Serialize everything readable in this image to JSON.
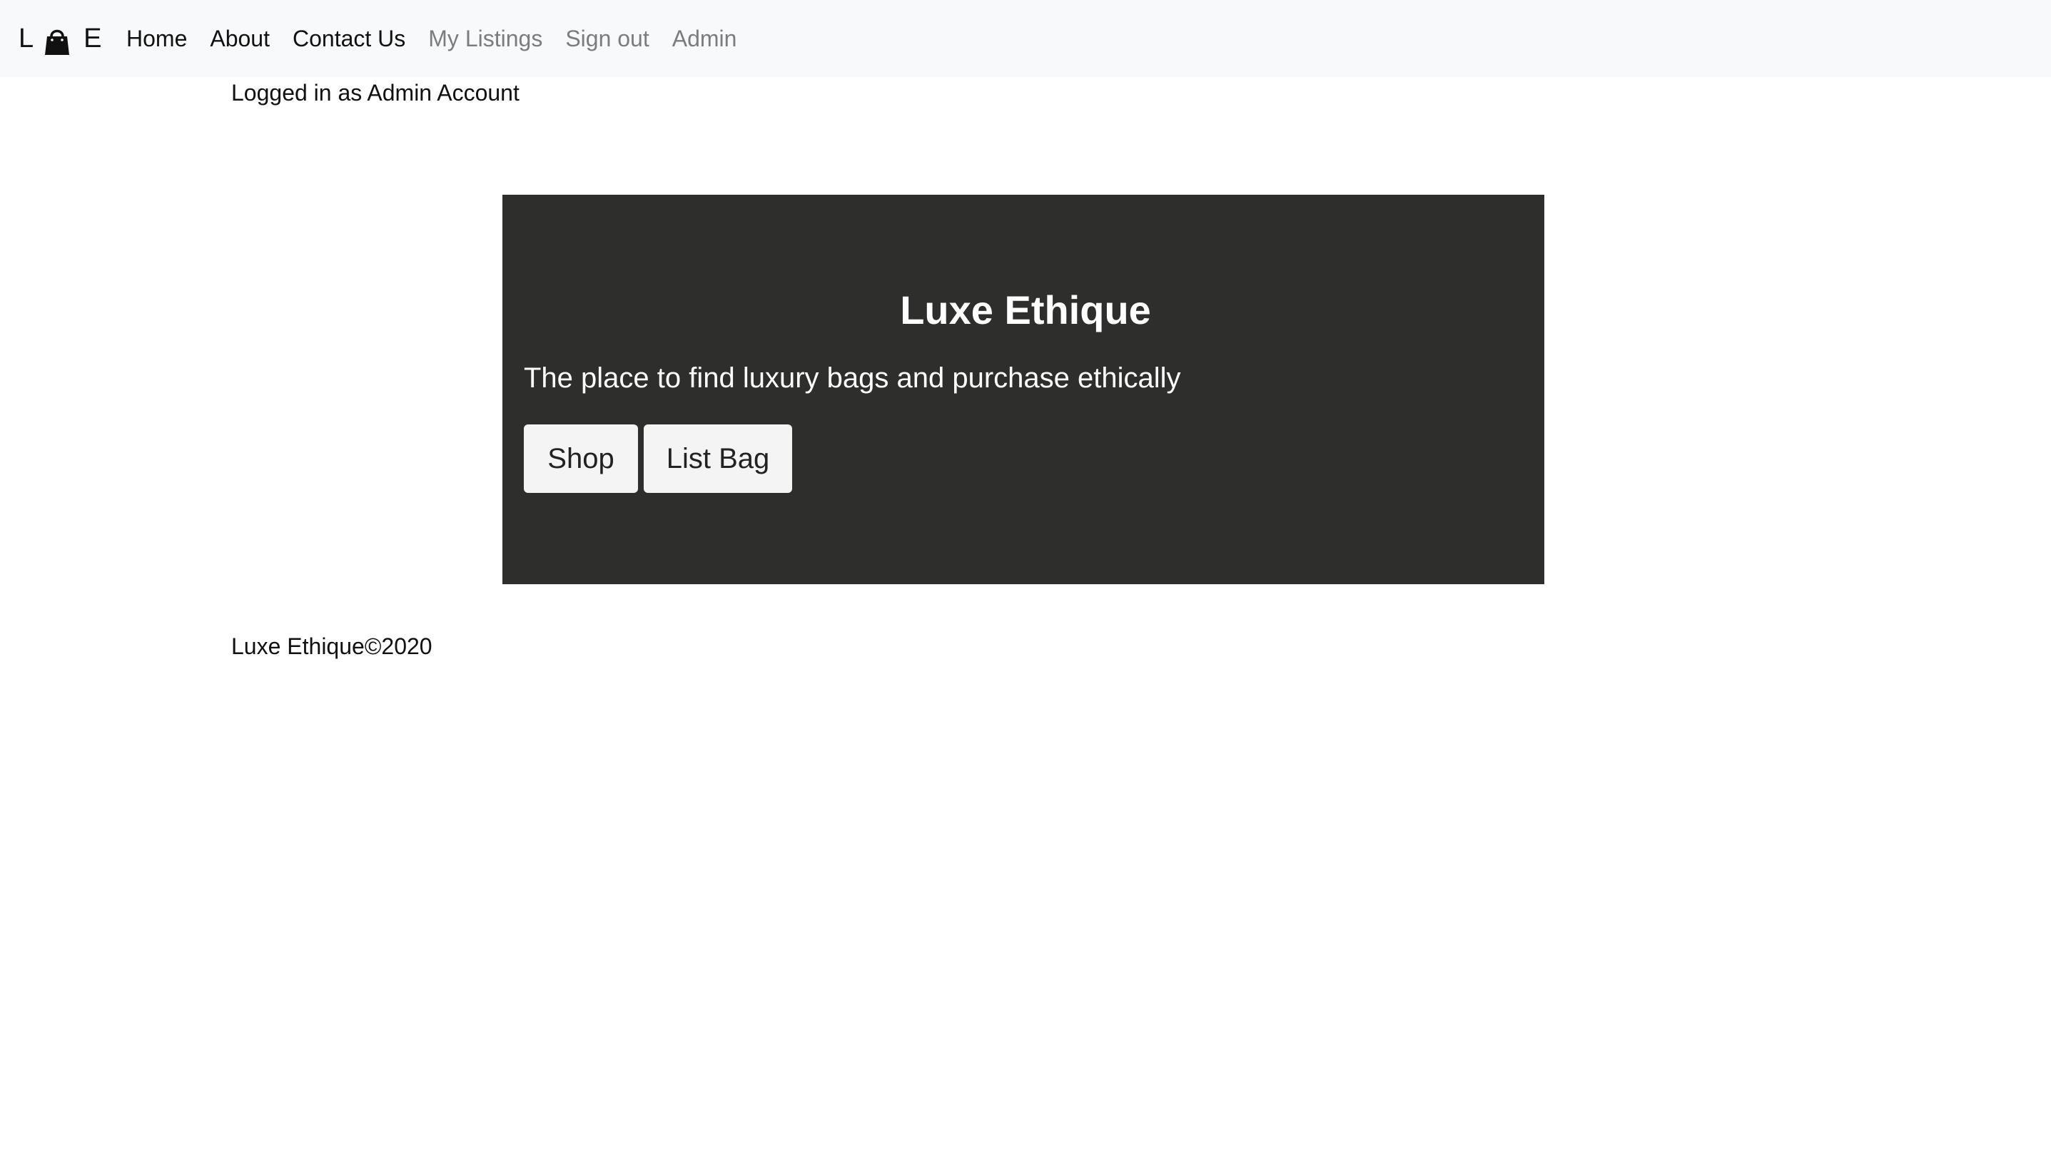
{
  "navbar": {
    "brand": {
      "left_letter": "L",
      "right_letter": "E",
      "icon": "handbag-icon"
    },
    "links": [
      {
        "label": "Home",
        "state": "active"
      },
      {
        "label": "About",
        "state": "active"
      },
      {
        "label": "Contact Us",
        "state": "active"
      },
      {
        "label": "My Listings",
        "state": "muted"
      },
      {
        "label": "Sign out",
        "state": "muted"
      },
      {
        "label": "Admin",
        "state": "muted"
      }
    ]
  },
  "status": {
    "logged_in_text": "Logged in as Admin Account"
  },
  "hero": {
    "title": "Luxe Ethique",
    "subtitle": "The place to find luxury bags and purchase ethically",
    "shop_label": "Shop",
    "list_bag_label": "List Bag"
  },
  "footer": {
    "text": "Luxe Ethique©2020"
  },
  "colors": {
    "navbar_bg": "#f8f9fa",
    "hero_bg": "#2e2e2c",
    "muted_link": "#7a7d80",
    "button_bg": "#f4f4f4"
  }
}
